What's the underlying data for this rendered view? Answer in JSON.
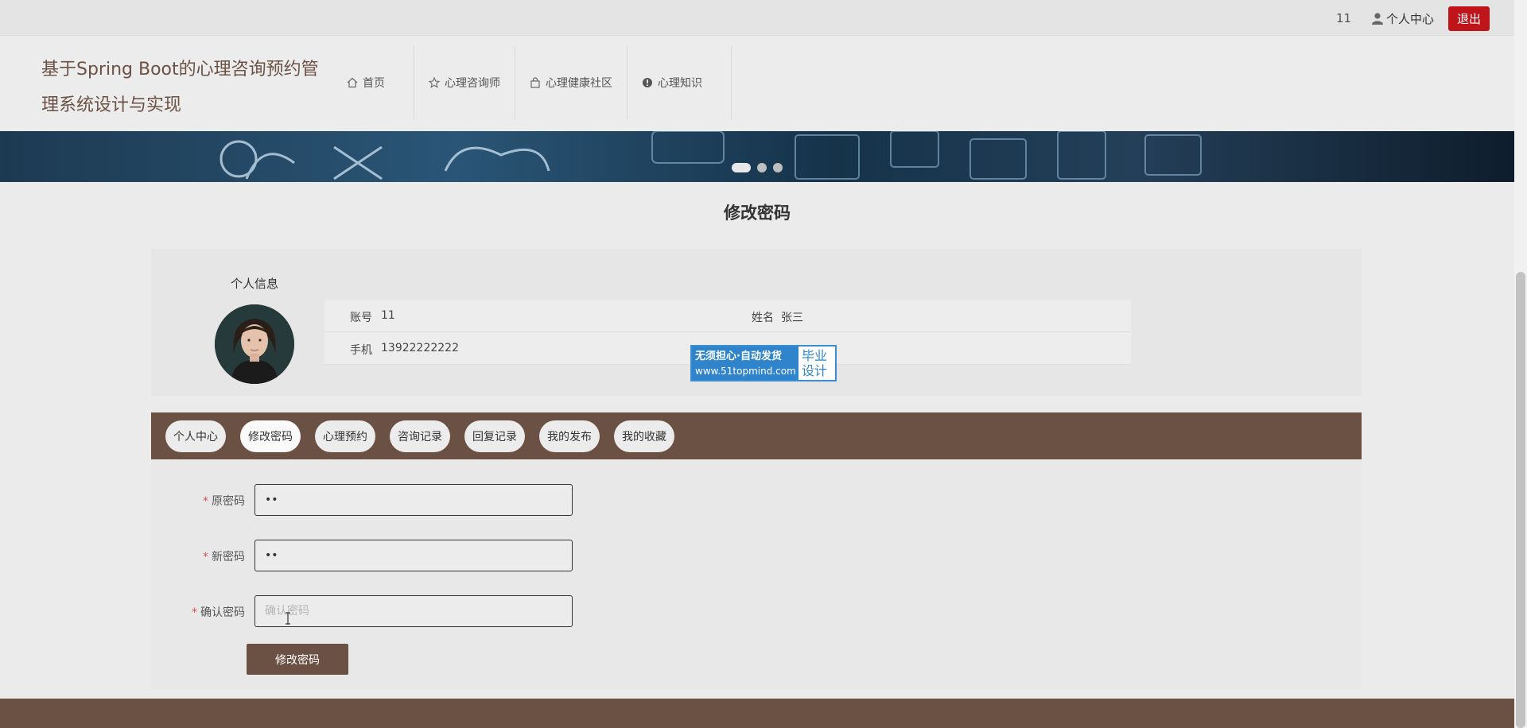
{
  "topbar": {
    "user_id": "11",
    "personal_center": "个人中心",
    "logout": "退出"
  },
  "header": {
    "site_title": "基于Spring Boot的心理咨询预约管理系统设计与实现",
    "nav": [
      {
        "label": "首页",
        "icon": "home-icon"
      },
      {
        "label": "心理咨询师",
        "icon": "star-icon"
      },
      {
        "label": "心理健康社区",
        "icon": "bag-icon"
      },
      {
        "label": "心理知识",
        "icon": "alert-icon"
      }
    ]
  },
  "page_title": "修改密码",
  "info": {
    "section_label": "个人信息",
    "account_label": "账号",
    "account_value": "11",
    "name_label": "姓名",
    "name_value": "张三",
    "phone_label": "手机",
    "phone_value": "13922222222"
  },
  "watermark": {
    "line1": "无须担心·自动发货",
    "line2": "www.51topmind.com",
    "right1": "毕业",
    "right2": "设计"
  },
  "tabs": [
    "个人中心",
    "修改密码",
    "心理预约",
    "咨询记录",
    "回复记录",
    "我的发布",
    "我的收藏"
  ],
  "form": {
    "old_label": "原密码",
    "old_value": "••",
    "new_label": "新密码",
    "new_value": "••",
    "confirm_label": "确认密码",
    "confirm_placeholder": "确认密码",
    "submit": "修改密码"
  },
  "colors": {
    "brand_brown": "#6b5144",
    "logout_red": "#c0141b",
    "required_star": "#d9534f"
  }
}
